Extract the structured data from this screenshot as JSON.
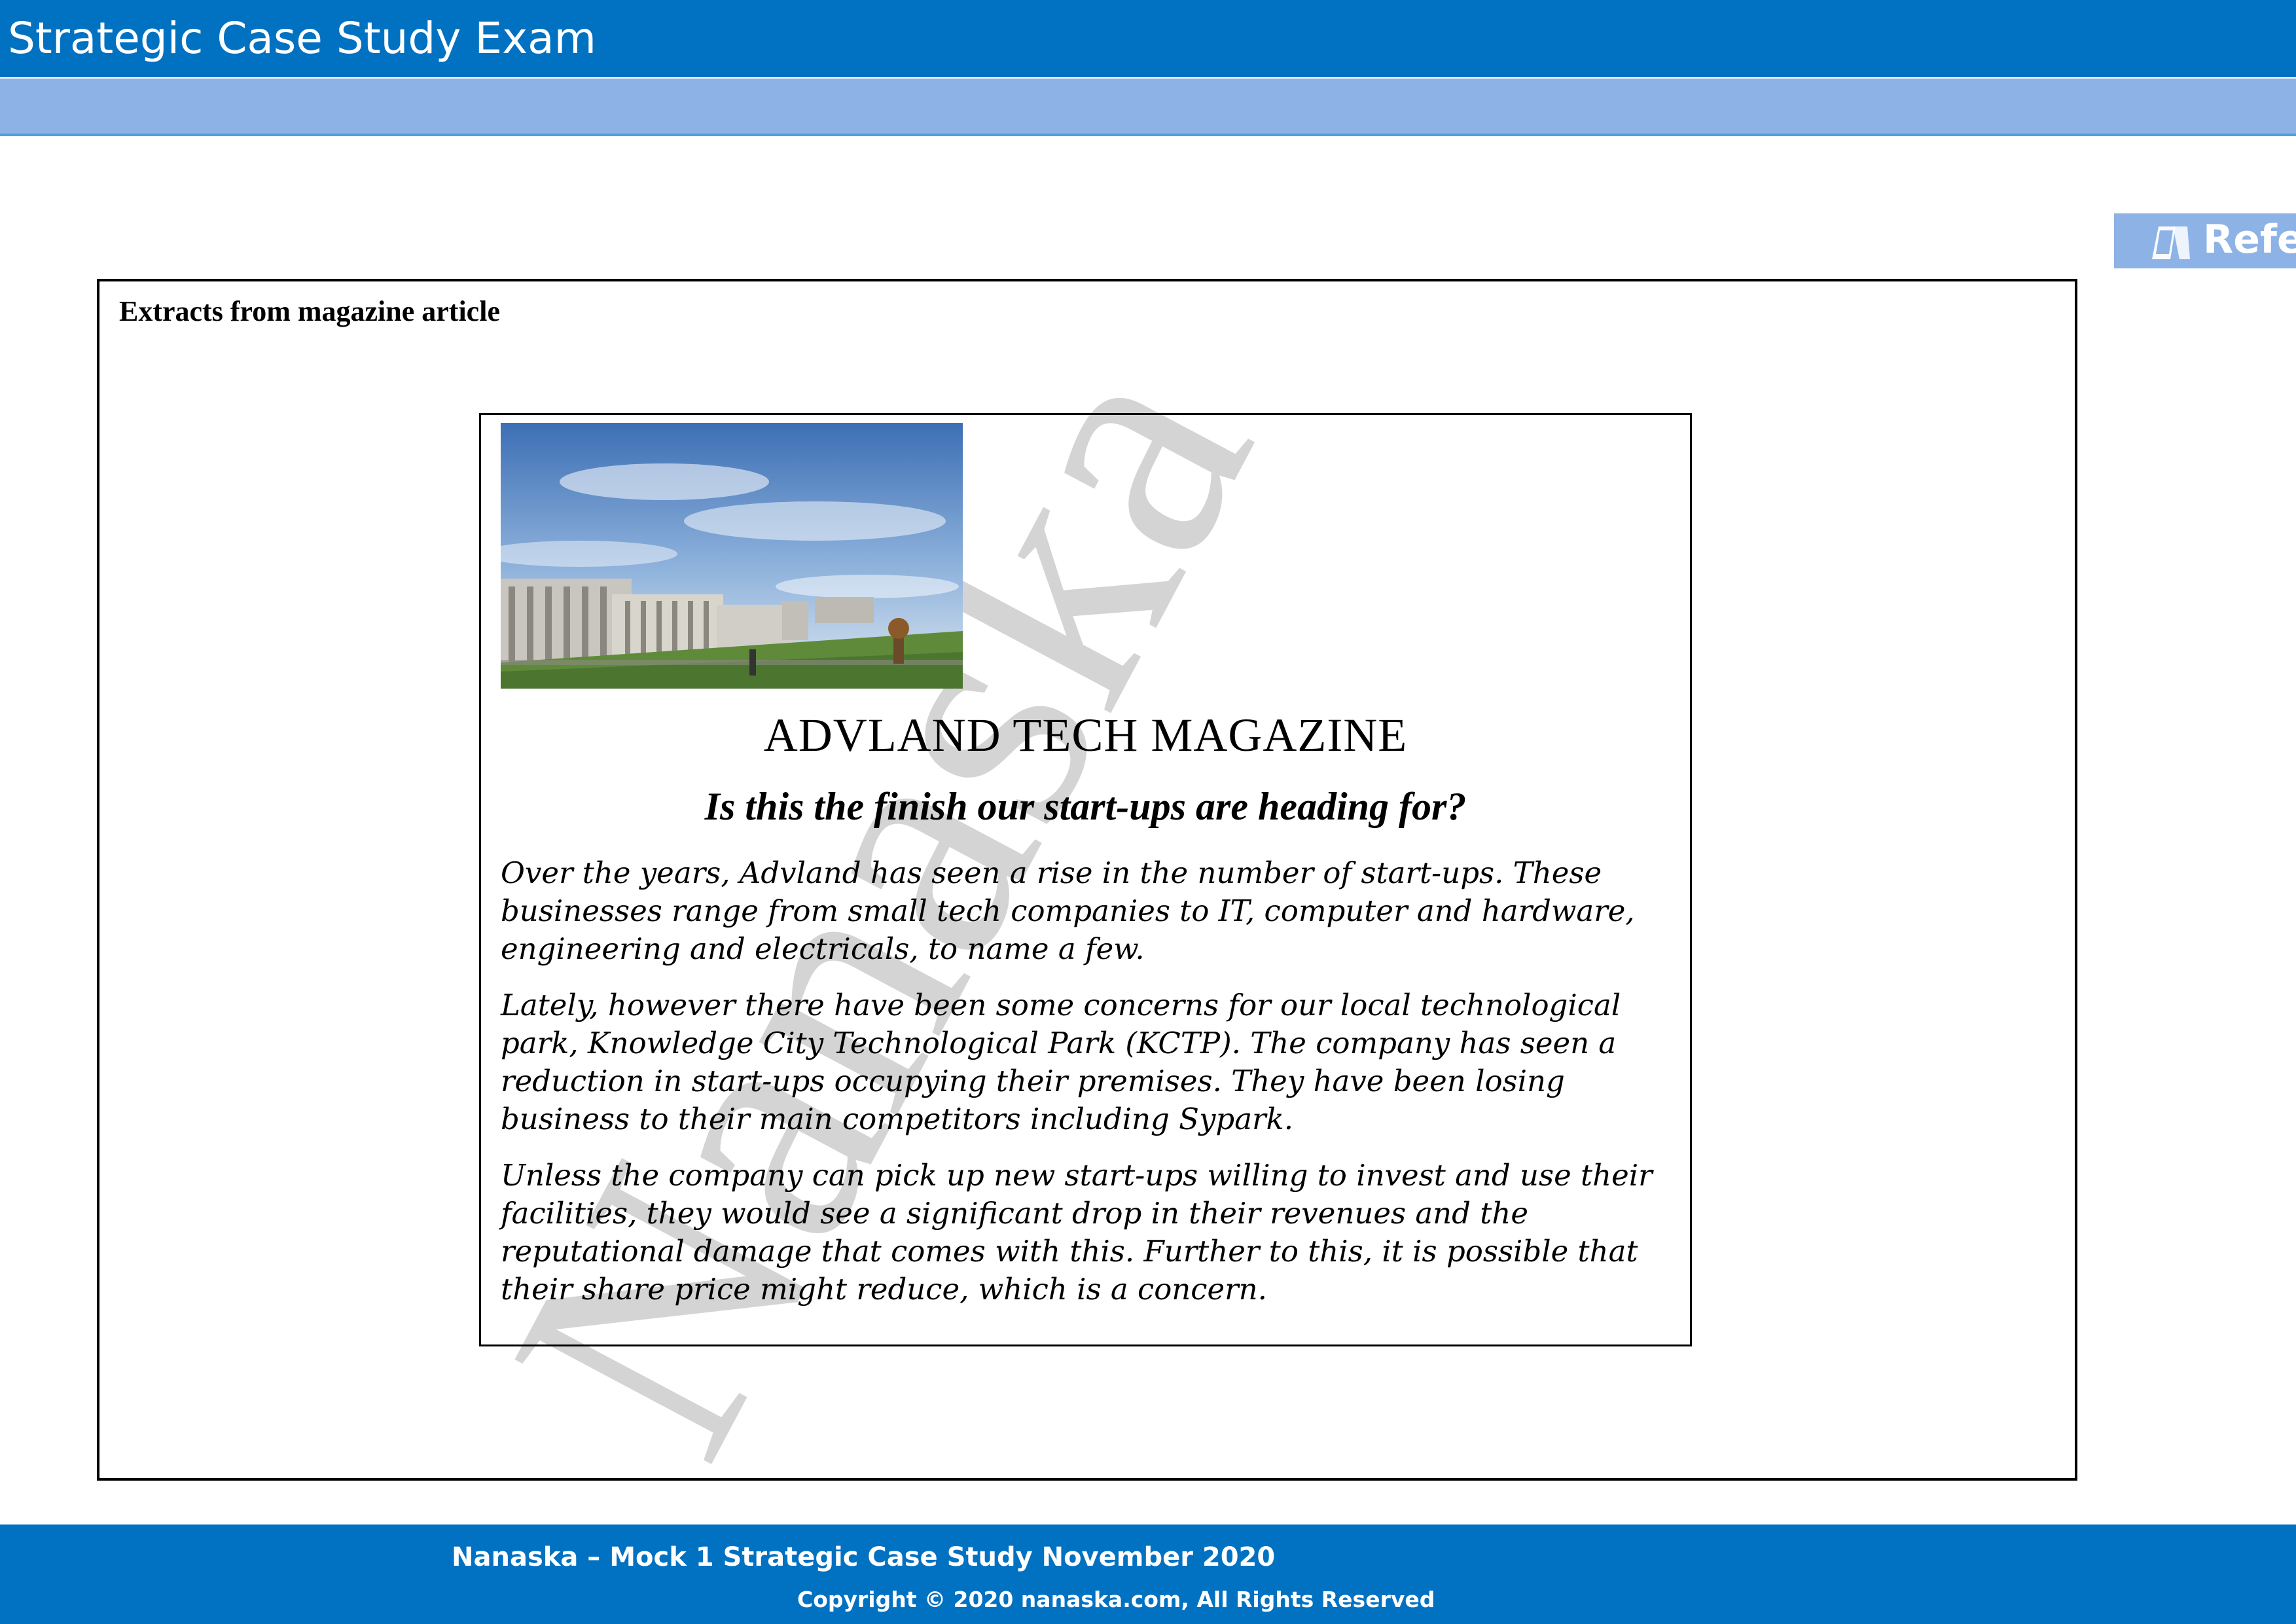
{
  "header": {
    "title": "Strategic Case Study Exam"
  },
  "reference_tab": {
    "label": "Refe",
    "icon": "book-icon"
  },
  "watermark": {
    "text": "Nanaska"
  },
  "exhibit": {
    "heading": "Extracts from magazine article"
  },
  "article": {
    "image": "building-photo",
    "title": "ADVLAND TECH MAGAZINE",
    "subtitle": "Is this the finish our start-ups are heading for?",
    "paragraphs": [
      "Over the years, Advland has seen a rise in the number of start-ups. These businesses range from small tech companies to IT, computer and hardware, engineering and electricals, to name a few.",
      "Lately, however there have been some concerns for our local technological park, Knowledge City Technological Park (KCTP). The company has seen a reduction in start-ups occupying their premises. They have been losing business to their main competitors including Sypark.",
      "Unless the company can pick up new start-ups willing to invest and use their facilities, they would see a significant drop in their revenues and the reputational damage that comes with this. Further to this, it is possible that their share price might reduce, which is a concern."
    ]
  },
  "footer": {
    "line1": "Nanaska – Mock 1 Strategic Case Study November 2020",
    "line2": "Copyright © 2020 nanaska.com, All Rights Reserved"
  },
  "colors": {
    "primary_blue": "#0171c2",
    "light_blue": "#8db3e6",
    "watermark_grey": "#d4d4d4"
  }
}
